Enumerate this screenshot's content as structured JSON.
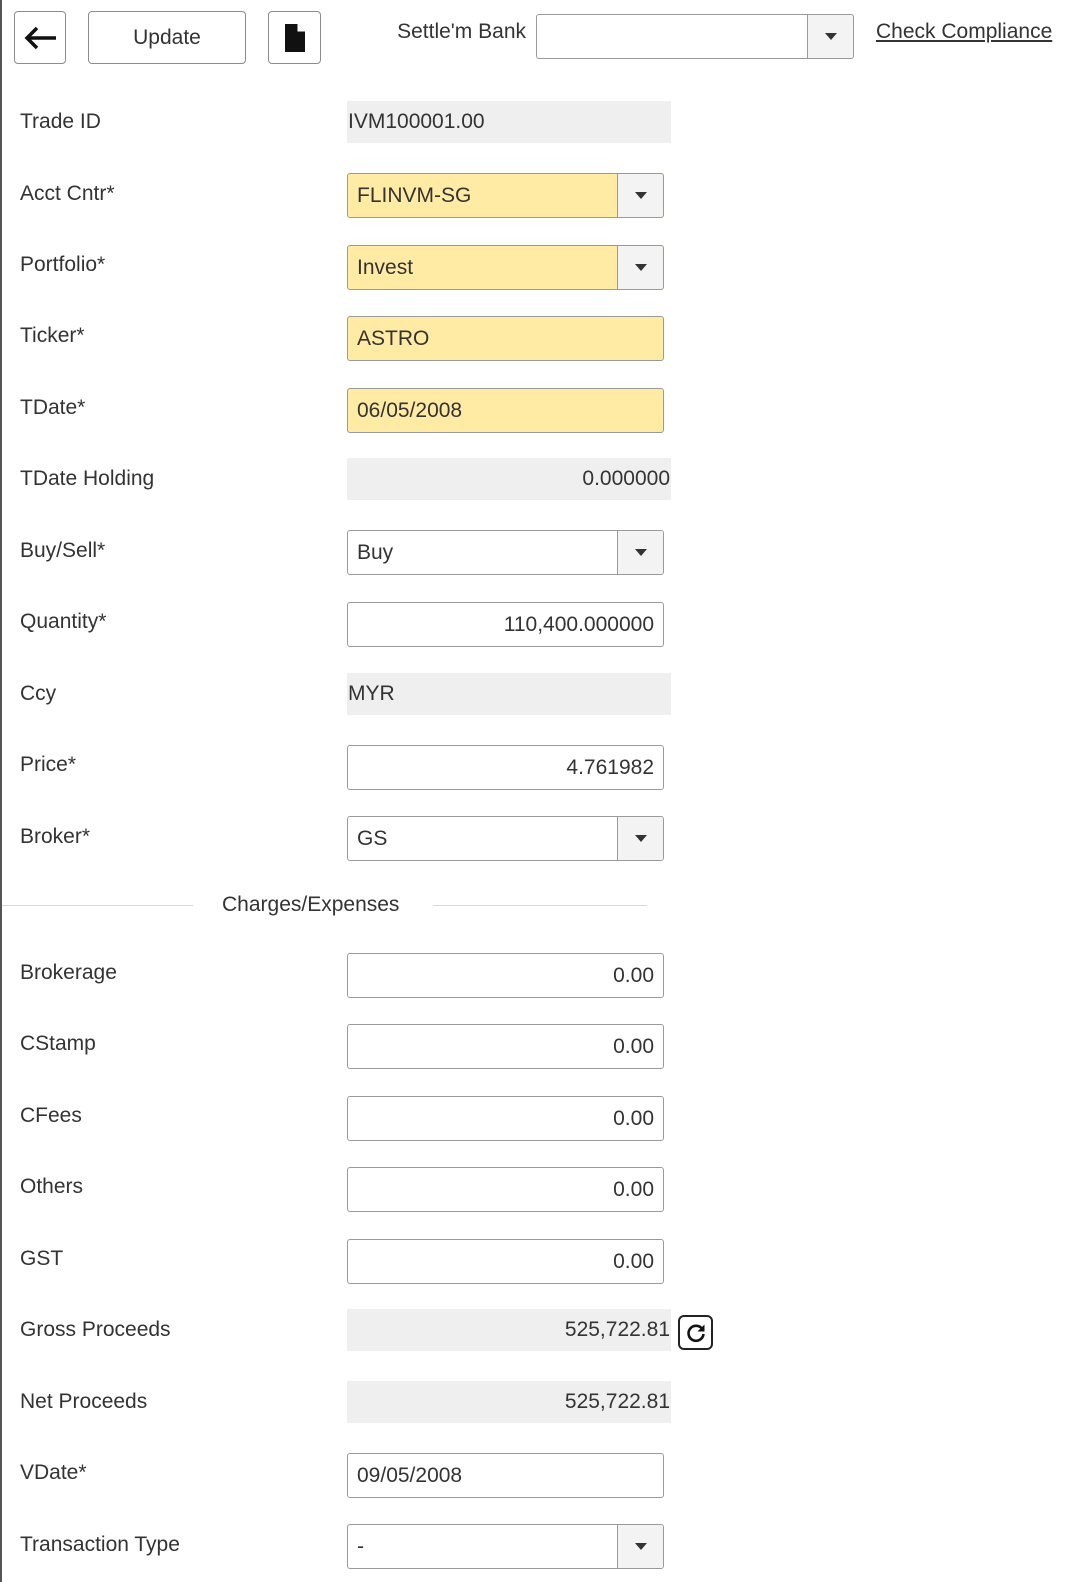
{
  "toolbar": {
    "back_icon": "arrow-left-icon",
    "update_label": "Update",
    "doc_icon": "document-icon",
    "settle_bank_label": "Settle'm Bank",
    "settle_bank_value": "",
    "check_compliance_label": "Check Compliance"
  },
  "form": {
    "trade_id": {
      "label": "Trade ID",
      "value": "IVM100001.00"
    },
    "acct_cntr": {
      "label": "Acct Cntr*",
      "value": "FLINVM-SG"
    },
    "portfolio": {
      "label": "Portfolio*",
      "value": "Invest"
    },
    "ticker": {
      "label": "Ticker*",
      "value": "ASTRO"
    },
    "tdate": {
      "label": "TDate*",
      "value": "06/05/2008"
    },
    "tdate_holding": {
      "label": "TDate Holding",
      "value": "0.000000"
    },
    "buy_sell": {
      "label": "Buy/Sell*",
      "value": "Buy"
    },
    "quantity": {
      "label": "Quantity*",
      "value": "110,400.000000"
    },
    "ccy": {
      "label": "Ccy",
      "value": "MYR"
    },
    "price": {
      "label": "Price*",
      "value": "4.761982"
    },
    "broker": {
      "label": "Broker*",
      "value": "GS"
    }
  },
  "charges": {
    "section_title": "Charges/Expenses",
    "brokerage": {
      "label": "Brokerage",
      "value": "0.00"
    },
    "cstamp": {
      "label": "CStamp",
      "value": "0.00"
    },
    "cfees": {
      "label": "CFees",
      "value": "0.00"
    },
    "others": {
      "label": "Others",
      "value": "0.00"
    },
    "gst": {
      "label": "GST",
      "value": "0.00"
    },
    "gross_proceeds": {
      "label": "Gross Proceeds",
      "value": "525,722.81"
    },
    "net_proceeds": {
      "label": "Net Proceeds",
      "value": "525,722.81"
    },
    "vdate": {
      "label": "VDate*",
      "value": "09/05/2008"
    },
    "transaction_type": {
      "label": "Transaction Type",
      "value": "-"
    }
  },
  "colors": {
    "required_field_bg": "#ffeba4",
    "readonly_bg": "#efefef",
    "border": "#9a9a9a"
  }
}
